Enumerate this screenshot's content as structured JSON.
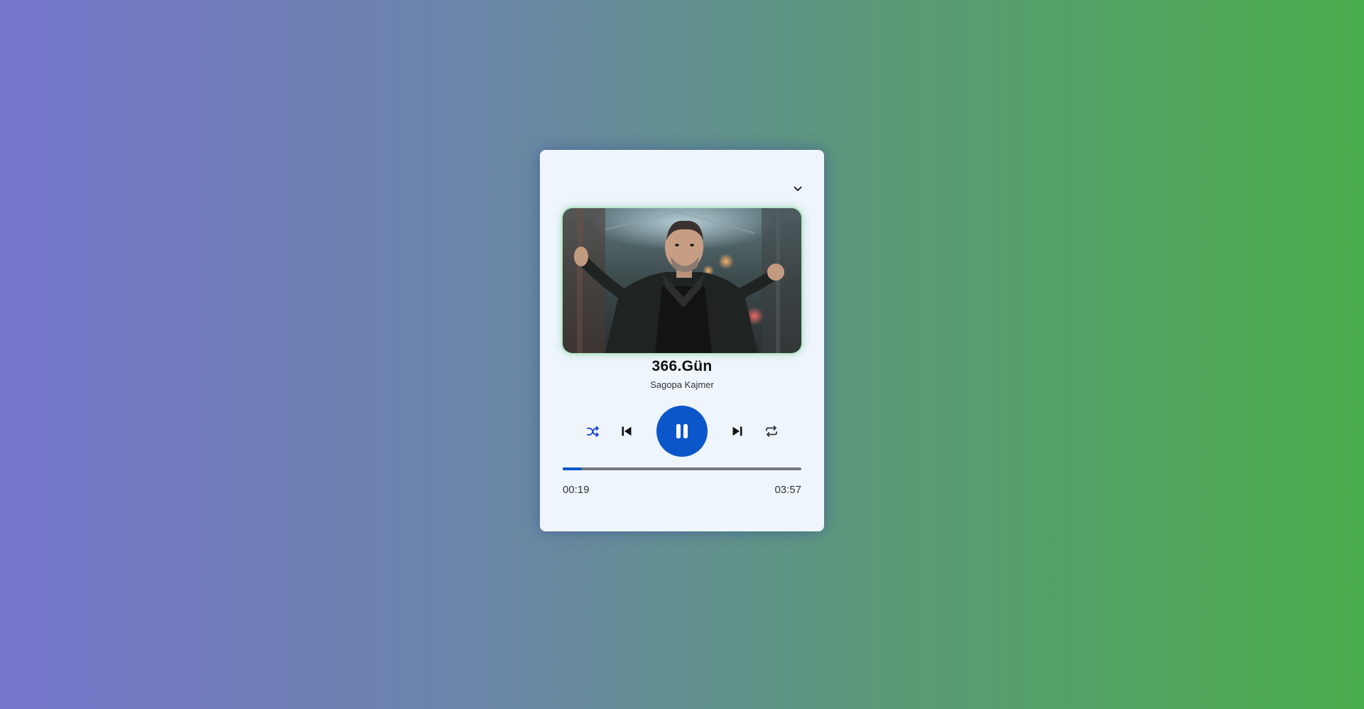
{
  "song": {
    "title": "366.Gün",
    "artist": "Sagopa Kajmer"
  },
  "progress": {
    "current_time": "00:19",
    "total_time": "03:57",
    "fraction": 0.08
  },
  "icons": {
    "dropdown": "chevron-down-icon",
    "shuffle": "shuffle-icon",
    "previous": "skip-previous-icon",
    "play_pause": "pause-icon",
    "next": "skip-next-icon",
    "repeat": "repeat-icon"
  },
  "colors": {
    "accent": "#0b57c9",
    "shuffle_active": "#1a3fd8",
    "card_background": "#eef5fc",
    "track": "#75797f",
    "gradient_start": "#7675cc",
    "gradient_end": "#4aad4c"
  }
}
